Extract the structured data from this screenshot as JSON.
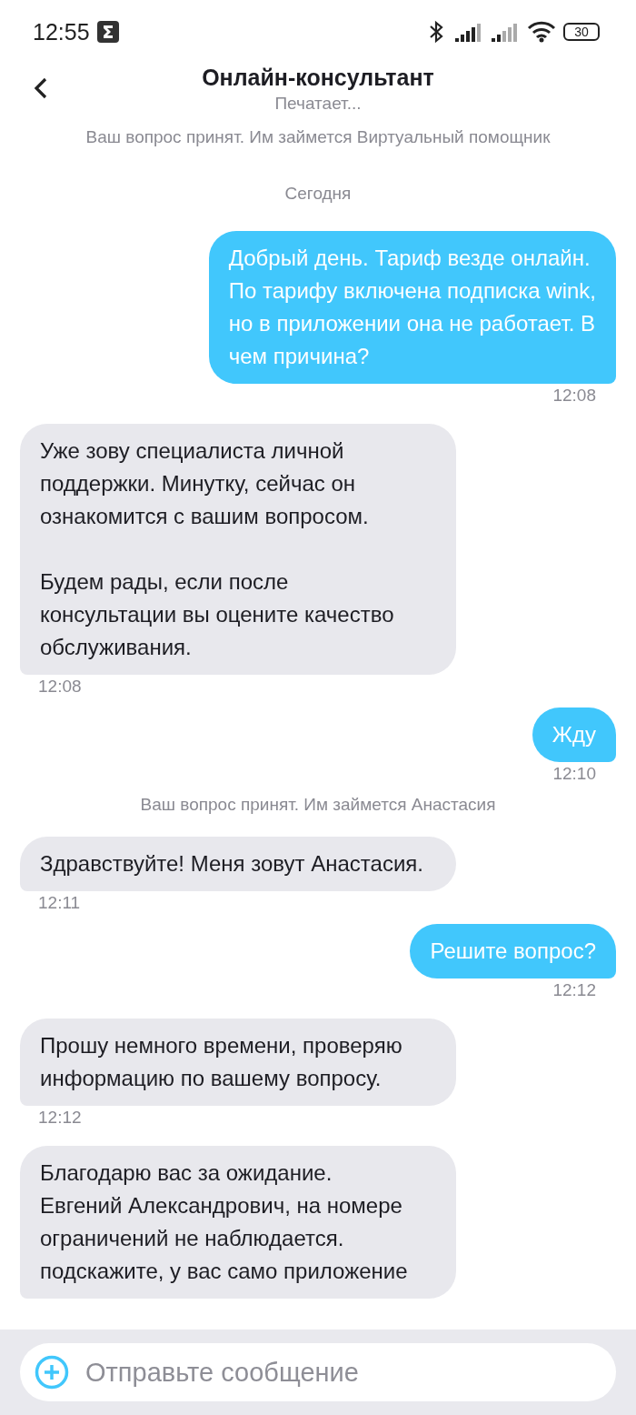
{
  "status_bar": {
    "time": "12:55",
    "battery": "30"
  },
  "header": {
    "title": "Онлайн-консультант",
    "subtitle": "Печатает..."
  },
  "messages": [
    {
      "kind": "system",
      "text": "Ваш вопрос принят. Им займется Виртуальный помощник"
    },
    {
      "kind": "date",
      "text": "Сегодня"
    },
    {
      "kind": "outgoing",
      "text": "Добрый день. Тариф везде онлайн.\nПо тарифу включена подписка wink,\nно в приложении она не работает. В\nчем причина?",
      "time": "12:08"
    },
    {
      "kind": "incoming",
      "paragraphs": [
        "Уже зову специалиста личной\nподдержки. Минутку, сейчас он\nознакомится с вашим вопросом.",
        "Будем рады, если после\nконсультации вы оцените качество\nобслуживания."
      ],
      "time": "12:08"
    },
    {
      "kind": "outgoing",
      "text": "Жду",
      "time": "12:10"
    },
    {
      "kind": "system",
      "text": "Ваш вопрос принят. Им займется Анастасия"
    },
    {
      "kind": "incoming",
      "paragraphs": [
        "Здравствуйте! Меня зовут Анастасия."
      ],
      "time": "12:11"
    },
    {
      "kind": "outgoing",
      "text": "Решите вопрос?",
      "time": "12:12"
    },
    {
      "kind": "incoming",
      "paragraphs": [
        "Прошу немного времени, проверяю\nинформацию по вашему вопросу."
      ],
      "time": "12:12"
    },
    {
      "kind": "incoming",
      "paragraphs": [
        "Благодарю вас за ожидание.\nЕвгений Александрович, на номере\nограничений не наблюдается.\nподскажите, у вас само приложение"
      ]
    }
  ],
  "composer": {
    "placeholder": "Отправьте сообщение"
  }
}
